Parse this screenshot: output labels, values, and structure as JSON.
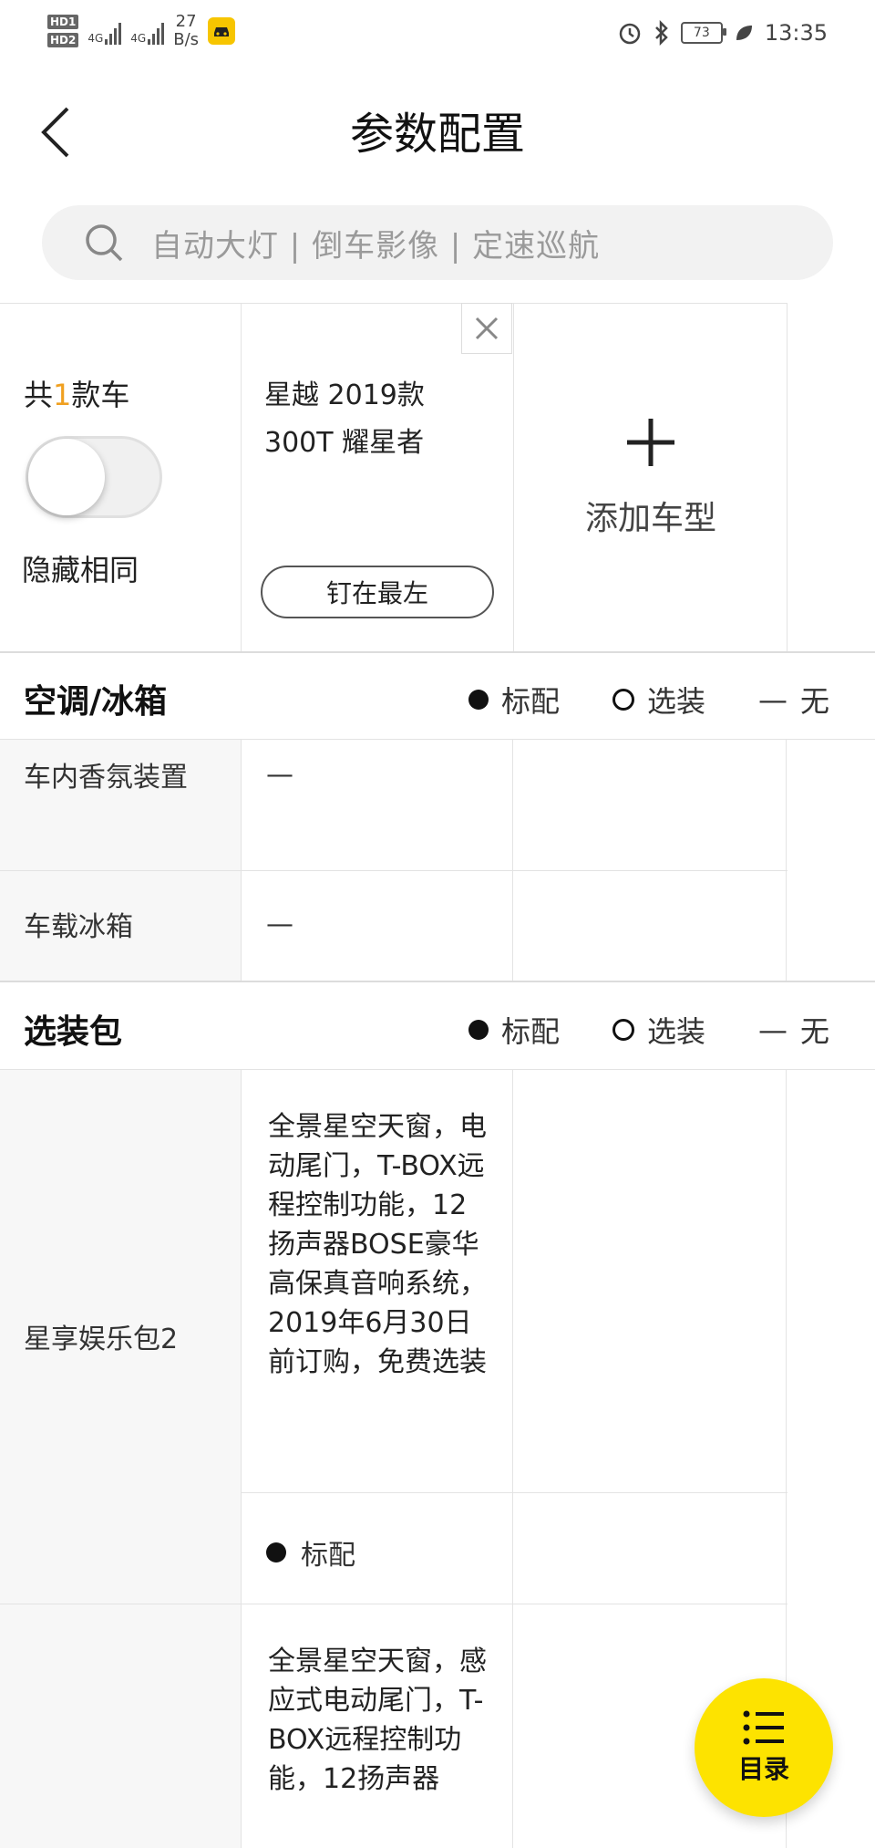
{
  "status_bar": {
    "hd1": "HD1",
    "hd2": "HD2",
    "net1": "4G",
    "net2": "4G",
    "speed_value": "27",
    "speed_unit": "B/s",
    "battery": "73",
    "time": "13:35"
  },
  "header": {
    "title": "参数配置",
    "back_icon": "chevron-left-icon"
  },
  "search": {
    "placeholder": "自动大灯 | 倒车影像 | 定速巡航"
  },
  "compare": {
    "count_prefix": "共",
    "count": "1",
    "count_suffix": "款车",
    "hide_same_label": "隐藏相同",
    "toggle_on": false,
    "car_name": "星越 2019款 300T 耀星者",
    "pin_label": "钉在最左",
    "add_label": "添加车型"
  },
  "legend": {
    "standard": "标配",
    "optional": "选装",
    "none": "无",
    "none_symbol": "—"
  },
  "sections": [
    {
      "title": "空调/冰箱",
      "rows": [
        {
          "label": "车内香氛装置",
          "value": "—"
        },
        {
          "label": "车载冰箱",
          "value": "—"
        }
      ]
    },
    {
      "title": "选装包",
      "rows": [
        {
          "label": "星享娱乐包2",
          "text": "全景星空天窗，电动尾门，T-BOX远程控制功能，12扬声器BOSE豪华高保真音响系统，2019年6月30日前订购，免费选装",
          "status": "标配"
        },
        {
          "label": "",
          "text": "全景星空天窗，感应式电动尾门，T-BOX远程控制功能，12扬声器"
        }
      ]
    }
  ],
  "fab": {
    "label": "目录",
    "icon": "list-icon"
  },
  "colors": {
    "accent": "#fde300",
    "count_highlight": "#f0a020",
    "label_bg": "#f7f7f7"
  }
}
